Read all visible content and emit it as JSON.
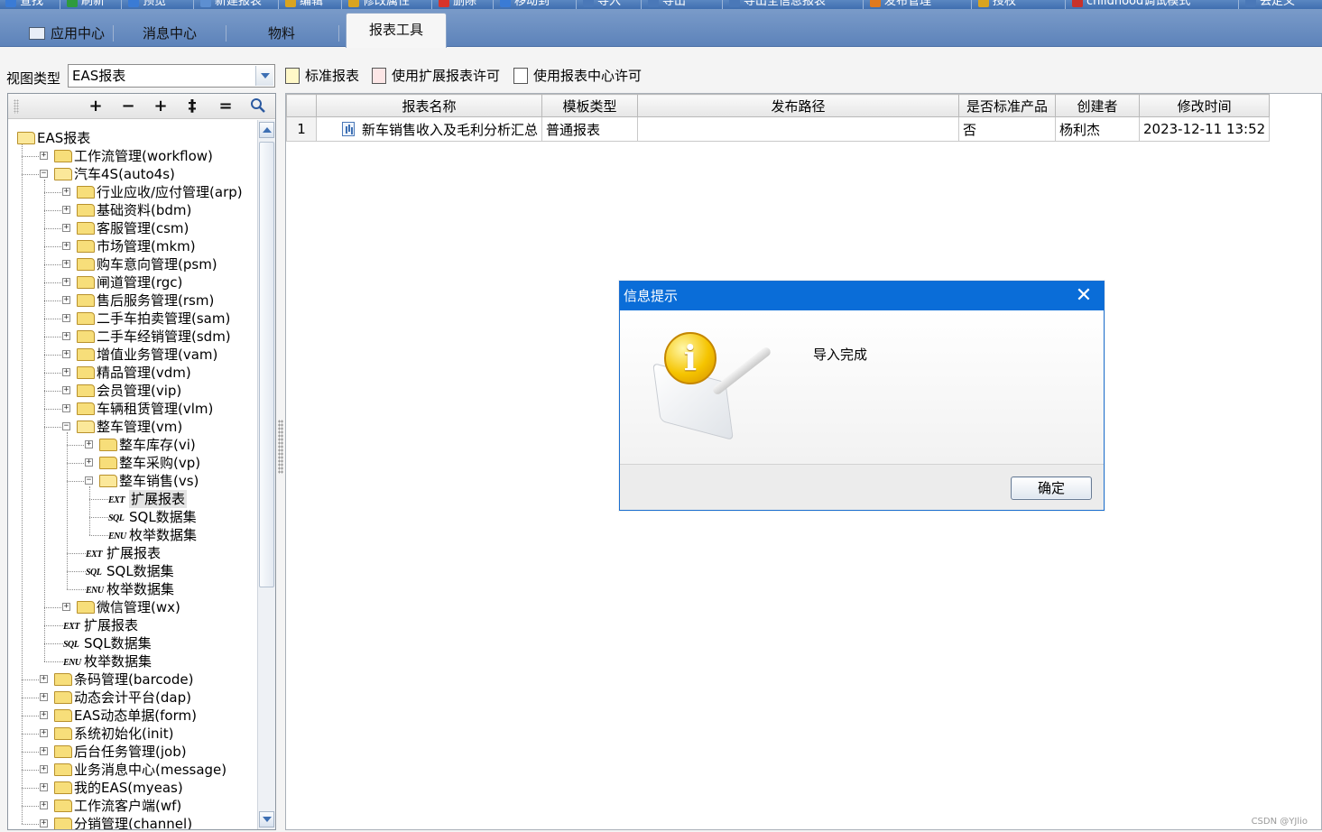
{
  "toolbar": {
    "items": [
      {
        "label": "查找"
      },
      {
        "label": "刷新"
      },
      {
        "label": "预览"
      },
      {
        "label": "新建报表"
      },
      {
        "label": "编辑"
      },
      {
        "label": "修改属性"
      },
      {
        "label": "删除"
      },
      {
        "label": "移动到"
      },
      {
        "label": "导入"
      },
      {
        "label": "导出"
      },
      {
        "label": "导出全信息报表"
      },
      {
        "label": "发布管理"
      },
      {
        "label": "授权"
      },
      {
        "label": "childhood调试模式"
      },
      {
        "label": "丢定义"
      }
    ]
  },
  "tabs": [
    {
      "label": "应用中心"
    },
    {
      "label": "消息中心"
    },
    {
      "label": "物料"
    },
    {
      "label": "报表工具"
    }
  ],
  "view": {
    "label": "视图类型",
    "selected": "EAS报表",
    "checkboxes": [
      {
        "label": "标准报表",
        "color": "#fff8c8"
      },
      {
        "label": "使用扩展报表许可",
        "color": "#fde6e6"
      },
      {
        "label": "使用报表中心许可",
        "color": "#ffffff"
      }
    ]
  },
  "tree_toolbar": {
    "buttons": [
      "+",
      "−",
      "+",
      "+",
      "=",
      "search"
    ]
  },
  "tree": [
    {
      "label": "EAS报表",
      "type": "folder-open",
      "level": 0,
      "expander": ""
    },
    {
      "label": "工作流管理(workflow)",
      "type": "folder",
      "level": 1,
      "expander": "+"
    },
    {
      "label": "汽车4S(auto4s)",
      "type": "folder-open",
      "level": 1,
      "expander": "−"
    },
    {
      "label": "行业应收/应付管理(arp)",
      "type": "folder",
      "level": 2,
      "expander": "+"
    },
    {
      "label": "基础资料(bdm)",
      "type": "folder",
      "level": 2,
      "expander": "+"
    },
    {
      "label": "客服管理(csm)",
      "type": "folder",
      "level": 2,
      "expander": "+"
    },
    {
      "label": "市场管理(mkm)",
      "type": "folder",
      "level": 2,
      "expander": "+"
    },
    {
      "label": "购车意向管理(psm)",
      "type": "folder",
      "level": 2,
      "expander": "+"
    },
    {
      "label": "闸道管理(rgc)",
      "type": "folder",
      "level": 2,
      "expander": "+"
    },
    {
      "label": "售后服务管理(rsm)",
      "type": "folder",
      "level": 2,
      "expander": "+"
    },
    {
      "label": "二手车拍卖管理(sam)",
      "type": "folder",
      "level": 2,
      "expander": "+"
    },
    {
      "label": "二手车经销管理(sdm)",
      "type": "folder",
      "level": 2,
      "expander": "+"
    },
    {
      "label": "增值业务管理(vam)",
      "type": "folder",
      "level": 2,
      "expander": "+"
    },
    {
      "label": "精品管理(vdm)",
      "type": "folder",
      "level": 2,
      "expander": "+"
    },
    {
      "label": "会员管理(vip)",
      "type": "folder",
      "level": 2,
      "expander": "+"
    },
    {
      "label": "车辆租赁管理(vlm)",
      "type": "folder",
      "level": 2,
      "expander": "+"
    },
    {
      "label": "整车管理(vm)",
      "type": "folder-open",
      "level": 2,
      "expander": "−"
    },
    {
      "label": "整车库存(vi)",
      "type": "folder",
      "level": 3,
      "expander": "+"
    },
    {
      "label": "整车采购(vp)",
      "type": "folder",
      "level": 3,
      "expander": "+"
    },
    {
      "label": "整车销售(vs)",
      "type": "folder-open",
      "level": 3,
      "expander": "−"
    },
    {
      "label": "扩展报表",
      "type": "EXT",
      "level": 4,
      "expander": "",
      "selected": true
    },
    {
      "label": "SQL数据集",
      "type": "SQL",
      "level": 4,
      "expander": ""
    },
    {
      "label": "枚举数据集",
      "type": "ENU",
      "level": 4,
      "expander": ""
    },
    {
      "label": "扩展报表",
      "type": "EXT",
      "level": 3,
      "expander": ""
    },
    {
      "label": "SQL数据集",
      "type": "SQL",
      "level": 3,
      "expander": ""
    },
    {
      "label": "枚举数据集",
      "type": "ENU",
      "level": 3,
      "expander": ""
    },
    {
      "label": "微信管理(wx)",
      "type": "folder",
      "level": 2,
      "expander": "+"
    },
    {
      "label": "扩展报表",
      "type": "EXT",
      "level": 2,
      "expander": ""
    },
    {
      "label": "SQL数据集",
      "type": "SQL",
      "level": 2,
      "expander": ""
    },
    {
      "label": "枚举数据集",
      "type": "ENU",
      "level": 2,
      "expander": ""
    },
    {
      "label": "条码管理(barcode)",
      "type": "folder",
      "level": 1,
      "expander": "+"
    },
    {
      "label": "动态会计平台(dap)",
      "type": "folder",
      "level": 1,
      "expander": "+"
    },
    {
      "label": "EAS动态单据(form)",
      "type": "folder",
      "level": 1,
      "expander": "+"
    },
    {
      "label": "系统初始化(init)",
      "type": "folder",
      "level": 1,
      "expander": "+"
    },
    {
      "label": "后台任务管理(job)",
      "type": "folder",
      "level": 1,
      "expander": "+"
    },
    {
      "label": "业务消息中心(message)",
      "type": "folder",
      "level": 1,
      "expander": "+"
    },
    {
      "label": "我的EAS(myeas)",
      "type": "folder",
      "level": 1,
      "expander": "+"
    },
    {
      "label": "工作流客户端(wf)",
      "type": "folder",
      "level": 1,
      "expander": "+"
    },
    {
      "label": "分销管理(channel)",
      "type": "folder",
      "level": 1,
      "expander": "+"
    }
  ],
  "table": {
    "columns": [
      "",
      "报表名称",
      "模板类型",
      "发布路径",
      "是否标准产品",
      "创建者",
      "修改时间"
    ],
    "rows": [
      {
        "num": "1",
        "name": "新车销售收入及毛利分析汇总",
        "template": "普通报表",
        "path": "",
        "standard": "否",
        "creator": "杨利杰",
        "modified": "2023-12-11 13:52"
      }
    ]
  },
  "dialog": {
    "title": "信息提示",
    "message": "导入完成",
    "ok_label": "确定"
  },
  "watermark": "CSDN @YJlio"
}
